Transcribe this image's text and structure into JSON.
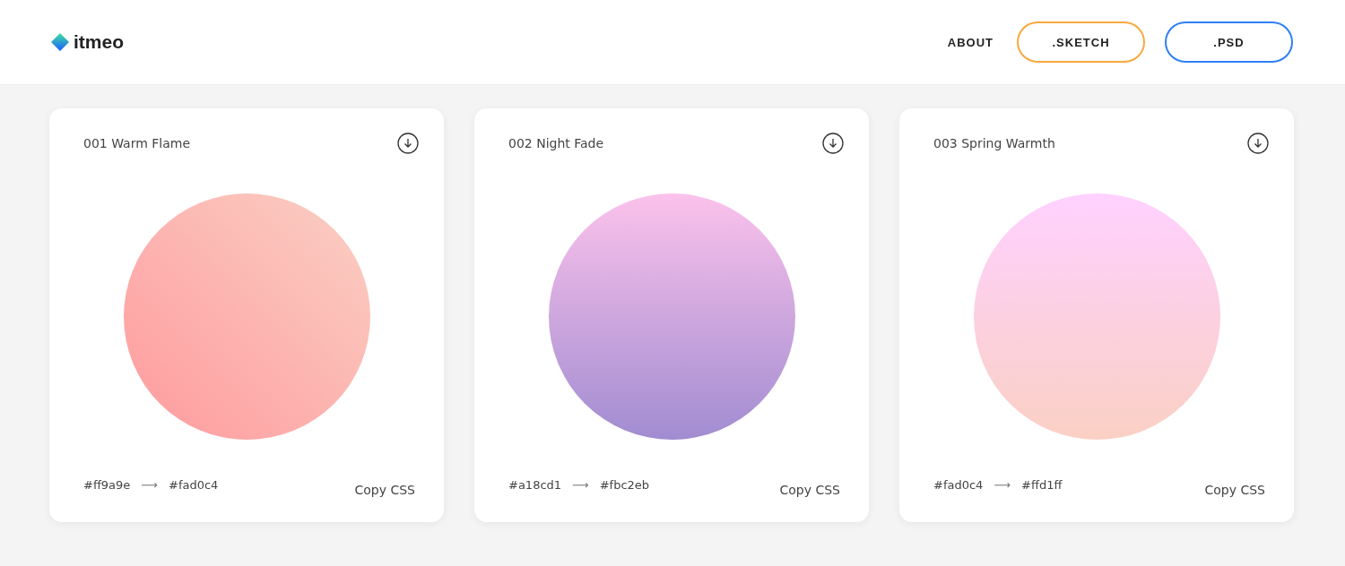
{
  "header": {
    "logo": "itmeo",
    "nav": [
      {
        "label": "ABOUT",
        "kind": "link"
      },
      {
        "label": ".SKETCH",
        "kind": "outline",
        "color": "#f7a93f"
      },
      {
        "label": ".PSD",
        "kind": "outline",
        "color": "#2f7ff7"
      }
    ]
  },
  "cards": [
    {
      "title": "001 Warm Flame",
      "kind": "diagonal",
      "from": "#ff9a9e",
      "to": "#fad0c4",
      "arrow": "⟶",
      "action": "Copy CSS"
    },
    {
      "title": "002 Night Fade",
      "kind": "vertical",
      "from": "#a18cd1",
      "to": "#fbc2eb",
      "arrow": "⟶",
      "action": "Copy CSS"
    },
    {
      "title": "003 Spring Warmth",
      "kind": "vertical",
      "from": "#fad0c4",
      "to": "#ffd1ff",
      "arrow": "⟶",
      "action": "Copy CSS"
    }
  ]
}
